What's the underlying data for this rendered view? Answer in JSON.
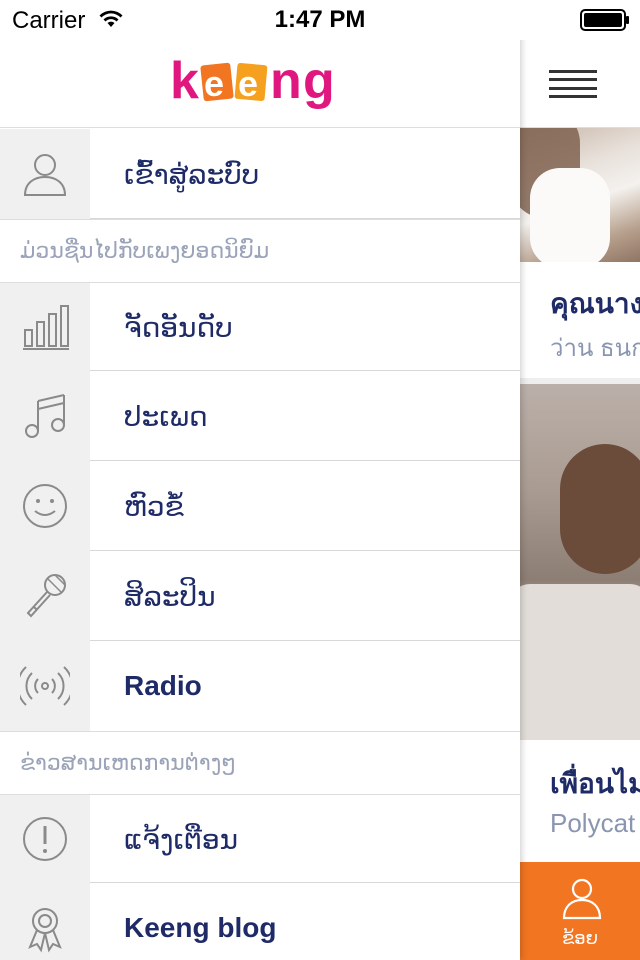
{
  "status_bar": {
    "carrier": "Carrier",
    "time": "1:47 PM"
  },
  "app": {
    "logo_text": "keeng",
    "accent_color": "#f27521",
    "text_color": "#1e2b66"
  },
  "menu": {
    "login": {
      "label": "ເຂົ້າສູ່ລະບົບ",
      "icon": "user-icon"
    },
    "section_music": {
      "label": "ມ່ວນຊື່ນໄປກັບເພງຍອດນິຍົມ"
    },
    "items_music": [
      {
        "label": "ຈັດອັນດັບ",
        "icon": "chart-bars-icon"
      },
      {
        "label": "ປະເພດ",
        "icon": "music-note-icon"
      },
      {
        "label": "ຫົວຂໍ້",
        "icon": "smiley-icon"
      },
      {
        "label": "ສິລະປິນ",
        "icon": "microphone-icon"
      },
      {
        "label": "Radio",
        "icon": "radio-broadcast-icon"
      }
    ],
    "section_news": {
      "label": "ຂ່າວສານເຫດການຕ່າງໆ"
    },
    "items_news": [
      {
        "label": "ແຈ້ງເຕືອນ",
        "icon": "alert-icon"
      },
      {
        "label": "Keeng blog",
        "icon": "award-ribbon-icon"
      }
    ]
  },
  "content": {
    "cards": [
      {
        "title": "คุณนาง",
        "subtitle": "ว่าน ธนก"
      },
      {
        "title": "เพื่อนไม",
        "subtitle": "Polycat"
      }
    ],
    "profile_tab": {
      "label": "ຂ້ອຍ",
      "icon": "user-icon"
    }
  }
}
